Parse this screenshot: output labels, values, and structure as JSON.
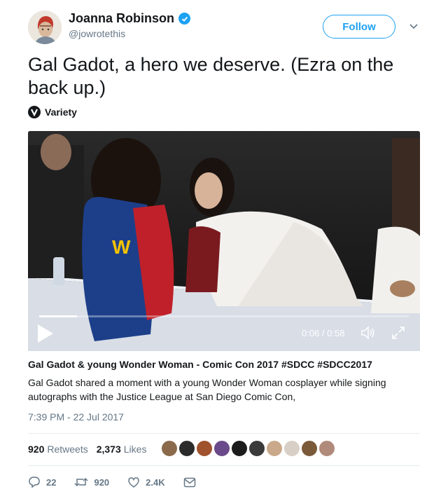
{
  "header": {
    "display_name": "Joanna Robinson",
    "handle": "@jowrotethis",
    "follow_label": "Follow"
  },
  "tweet": {
    "text": "Gal Gadot, a hero we deserve. (Ezra on the back up.)",
    "source": "Variety"
  },
  "video": {
    "time": "0:06 / 0:58",
    "progress": 0.103
  },
  "card": {
    "title": "Gal Gadot & young Wonder Woman - Comic Con 2017 #SDCC #SDCC2017",
    "description": "Gal Gadot shared a moment with a young Wonder Woman cosplayer while signing autographs with the Justice League at San Diego Comic Con,"
  },
  "timestamp": "7:39 PM - 22 Jul 2017",
  "stats": {
    "retweets_count": "920",
    "retweets_label": "Retweets",
    "likes_count": "2,373",
    "likes_label": "Likes"
  },
  "likers": [
    {
      "color": "#8a6a4a",
      "icon": "avatar-icon"
    },
    {
      "color": "#2b2b2b",
      "icon": "avatar-icon"
    },
    {
      "color": "#a0522d",
      "icon": "avatar-icon"
    },
    {
      "color": "#6a4a8a",
      "icon": "avatar-icon"
    },
    {
      "color": "#1c1c1c",
      "icon": "avatar-icon"
    },
    {
      "color": "#3a3a3a",
      "icon": "avatar-icon"
    },
    {
      "color": "#c9a98a",
      "icon": "avatar-icon"
    },
    {
      "color": "#d8d0c6",
      "icon": "avatar-icon"
    },
    {
      "color": "#7a5a3a",
      "icon": "avatar-icon"
    },
    {
      "color": "#b08a7a",
      "icon": "avatar-icon"
    }
  ],
  "actions": {
    "replies": "22",
    "retweets": "920",
    "likes": "2.4K"
  },
  "colors": {
    "accent": "#1da1f2",
    "text": "#14171a",
    "secondary": "#657786"
  }
}
